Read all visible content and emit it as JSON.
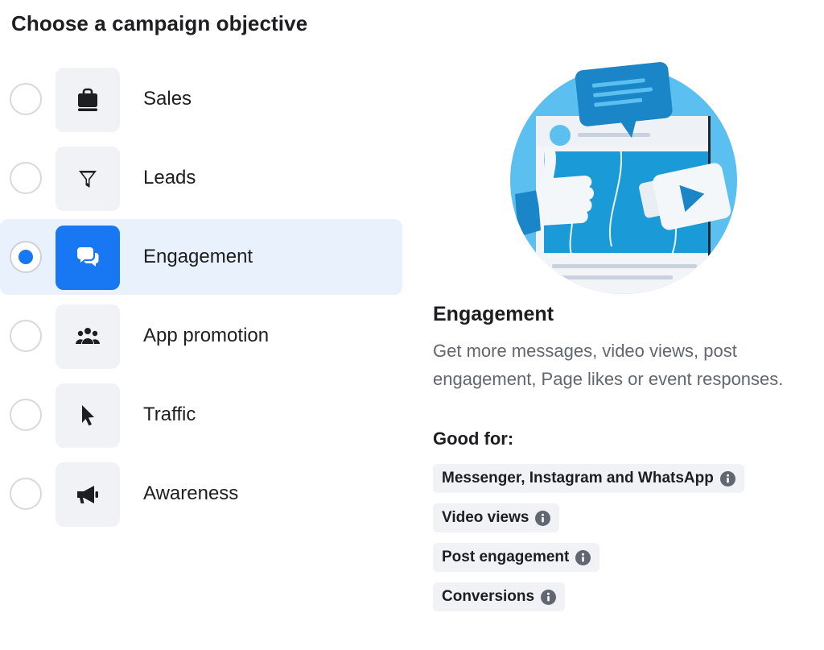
{
  "page": {
    "title": "Choose a campaign objective"
  },
  "objectives": [
    {
      "label": "Sales",
      "icon": "shopping-bag-icon",
      "selected": false
    },
    {
      "label": "Leads",
      "icon": "funnel-icon",
      "selected": false
    },
    {
      "label": "Engagement",
      "icon": "chat-bubbles-icon",
      "selected": true
    },
    {
      "label": "App promotion",
      "icon": "people-group-icon",
      "selected": false
    },
    {
      "label": "Traffic",
      "icon": "cursor-arrow-icon",
      "selected": false
    },
    {
      "label": "Awareness",
      "icon": "megaphone-icon",
      "selected": false
    }
  ],
  "detail": {
    "title": "Engagement",
    "description": "Get more messages, video views, post engagement, Page likes or event responses.",
    "good_for_label": "Good for:",
    "chips": [
      "Messenger, Instagram and WhatsApp",
      "Video views",
      "Post engagement",
      "Conversions"
    ]
  },
  "colors": {
    "accent": "#1877f2",
    "selected_row": "#e9f1fd",
    "tile": "#f0f2f5",
    "muted_text": "#606770"
  }
}
